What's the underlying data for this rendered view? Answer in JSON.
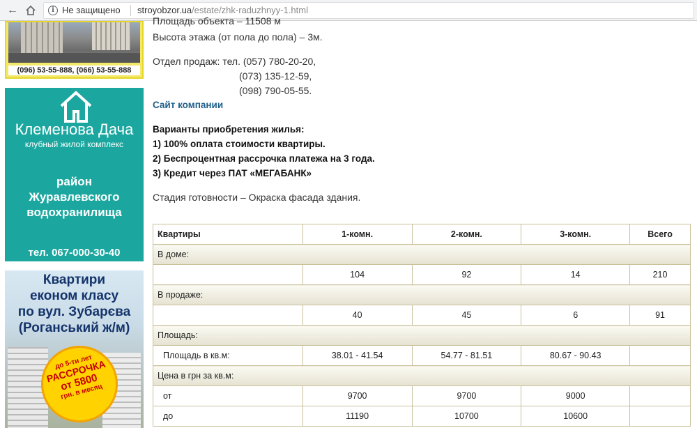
{
  "browser": {
    "security_label": "Не защищено",
    "url_host": "stroyobzor.ua",
    "url_path": "/estate/zhk-raduzhnyy-1.html"
  },
  "banners": {
    "top_phones": "(096) 53-55-888, (066) 53-55-888",
    "klemenova": {
      "title": "Клеменова Дача",
      "subtitle": "клубный жилой комплекс",
      "line1": "район",
      "line2": "Журавлевского",
      "line3": "водохранилища",
      "phone": "тел. 067-000-30-40"
    },
    "zubareva": {
      "line1": "Квартири",
      "line2": "економ класу",
      "line3": "по вул. Зубарєва",
      "line4": "(Роганський ж/м)",
      "promo1": "до 5-ти лет",
      "promo2": "РАССРОЧКА",
      "promo3": "от 5800",
      "promo4": "грн. в месяц"
    }
  },
  "content": {
    "area_line": "Площадь объекта – 11508 м",
    "height_line": "Высота этажа (от пола до пола) – 3м.",
    "sales_line": "Отдел продаж: тел. (057) 780-20-20,",
    "phone2": "(073) 135-12-59,",
    "phone3": "(098) 790-05-55.",
    "company_link": "Сайт компании",
    "purchase_title": "Варианты приобретения жилья:",
    "option1": "1) 100% оплата стоимости квартиры.",
    "option2": "2) Беспроцентная рассрочка платежа на 3 года.",
    "option3": "3) Кредит через ПАТ «МЕГАБАНК»",
    "stage": "Стадия готовности – Окраска фасада здания."
  },
  "table": {
    "headers": [
      "Квартиры",
      "1-комн.",
      "2-комн.",
      "3-комн.",
      "Всего"
    ],
    "rows": [
      {
        "type": "section",
        "label": "В доме:"
      },
      {
        "type": "data",
        "label": "",
        "values": [
          "104",
          "92",
          "14",
          "210"
        ]
      },
      {
        "type": "section",
        "label": "В продаже:"
      },
      {
        "type": "data",
        "label": "",
        "values": [
          "40",
          "45",
          "6",
          "91"
        ]
      },
      {
        "type": "section",
        "label": "Площадь:"
      },
      {
        "type": "data",
        "label": "Площадь в кв.м:",
        "values": [
          "38.01 - 41.54",
          "54.77 - 81.51",
          "80.67 - 90.43",
          ""
        ]
      },
      {
        "type": "section",
        "label": "Цена в грн за кв.м:"
      },
      {
        "type": "data",
        "label": "от",
        "values": [
          "9700",
          "9700",
          "9000",
          ""
        ]
      },
      {
        "type": "data",
        "label": "до",
        "values": [
          "11190",
          "10700",
          "10600",
          ""
        ]
      }
    ]
  }
}
